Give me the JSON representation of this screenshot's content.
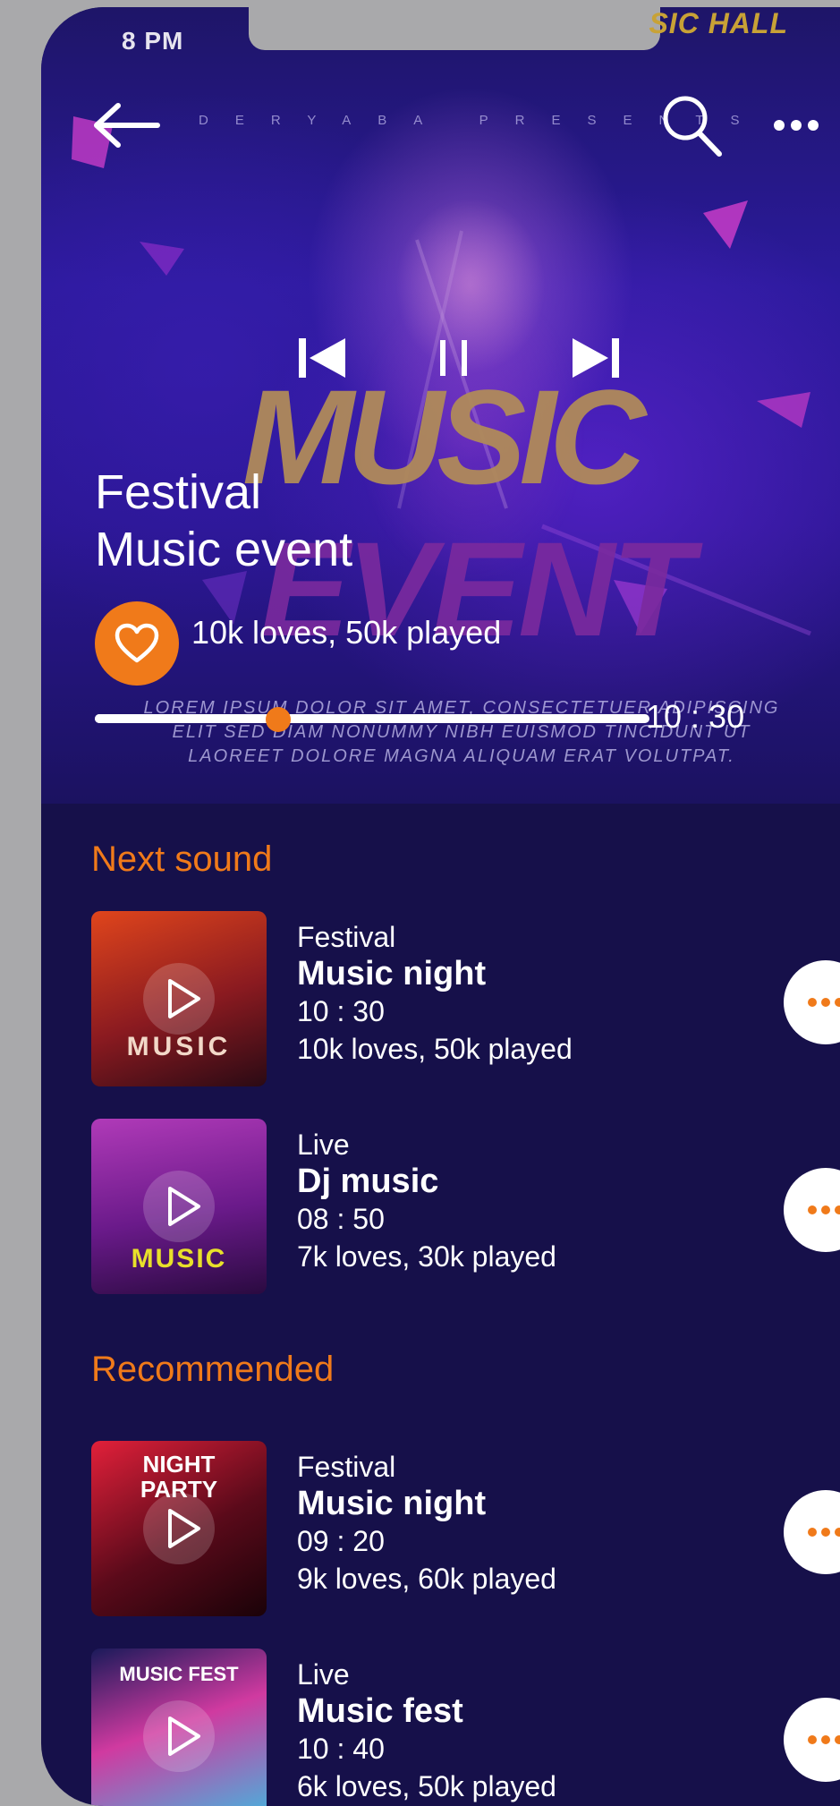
{
  "status_bar": {
    "time": "8 PM",
    "right_text": "SIC HALL"
  },
  "header": {
    "presents_text": "DERYABA PRESENTS"
  },
  "hero": {
    "poster_line1": "MUSIC",
    "poster_line2": "EVENT",
    "poster_lorem": "LOREM IPSUM DOLOR SIT AMET, CONSECTETUER ADIPISCING ELIT SED DIAM NONUMMY NIBH EUISMOD TINCIDUNT UT LAOREET DOLORE MAGNA ALIQUAM ERAT VOLUTPAT.",
    "title_line1": "Festival",
    "title_line2": "Music event",
    "stats": "10k loves, 50k played",
    "progress_fraction": 0.33,
    "time": "10 : 30"
  },
  "sections": {
    "next_sound": "Next sound",
    "recommended": "Recommended"
  },
  "next_sound": [
    {
      "category": "Festival",
      "title": "Music night",
      "time": "10 : 30",
      "stats": "10k loves, 50k played",
      "thumb_text": "MUSIC"
    },
    {
      "category": "Live",
      "title": "Dj music",
      "time": "08 : 50",
      "stats": "7k loves, 30k played",
      "thumb_text": "MUSIC"
    }
  ],
  "recommended": [
    {
      "category": "Festival",
      "title": "Music night",
      "time": "09 : 20",
      "stats": "9k loves, 60k played",
      "thumb_text": "NIGHT PARTY"
    },
    {
      "category": "Live",
      "title": "Music fest",
      "time": "10 : 40",
      "stats": "6k loves, 50k played",
      "thumb_text": "MUSIC FEST"
    }
  ],
  "colors": {
    "background": "#16104a",
    "accent": "#f07a1a",
    "text": "#ffffff"
  }
}
